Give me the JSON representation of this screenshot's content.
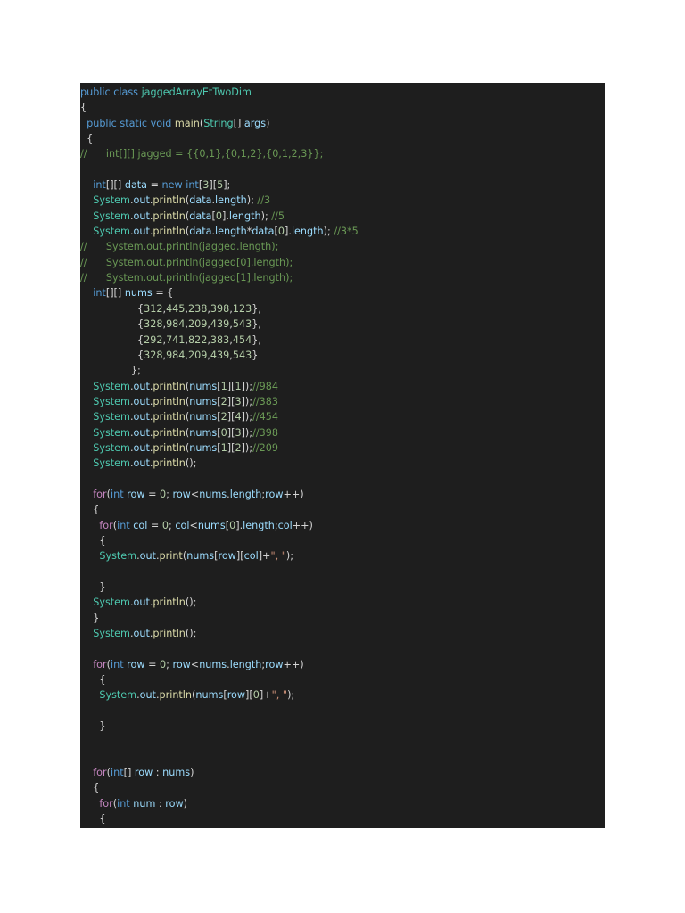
{
  "code": {
    "lines": [
      [
        [
          "public",
          "kw"
        ],
        [
          " ",
          "pl"
        ],
        [
          "class",
          "kw"
        ],
        [
          " ",
          "pl"
        ],
        [
          "jaggedArrayEtTwoDim",
          "type"
        ]
      ],
      [
        [
          "{",
          "pl"
        ]
      ],
      [
        [
          "  ",
          "pl"
        ],
        [
          "public",
          "kw"
        ],
        [
          " ",
          "pl"
        ],
        [
          "static",
          "kw"
        ],
        [
          " ",
          "pl"
        ],
        [
          "void",
          "kw"
        ],
        [
          " ",
          "pl"
        ],
        [
          "main",
          "fn"
        ],
        [
          "(",
          "pl"
        ],
        [
          "String",
          "type"
        ],
        [
          "[] ",
          "pl"
        ],
        [
          "args",
          "var"
        ],
        [
          ")",
          "pl"
        ]
      ],
      [
        [
          "  {",
          "pl"
        ]
      ],
      [
        [
          "//      int[][] jagged = {{0,1},{0,1,2},{0,1,2,3}};",
          "cm"
        ]
      ],
      [],
      [
        [
          "    ",
          "pl"
        ],
        [
          "int",
          "kw"
        ],
        [
          "[][] ",
          "pl"
        ],
        [
          "data",
          "var"
        ],
        [
          " = ",
          "pl"
        ],
        [
          "new",
          "kw"
        ],
        [
          " ",
          "pl"
        ],
        [
          "int",
          "kw"
        ],
        [
          "[",
          "pl"
        ],
        [
          "3",
          "num"
        ],
        [
          "][",
          "pl"
        ],
        [
          "5",
          "num"
        ],
        [
          "];",
          "pl"
        ]
      ],
      [
        [
          "    ",
          "pl"
        ],
        [
          "System",
          "type"
        ],
        [
          ".",
          "pl"
        ],
        [
          "out",
          "var"
        ],
        [
          ".",
          "pl"
        ],
        [
          "println",
          "fn"
        ],
        [
          "(",
          "pl"
        ],
        [
          "data",
          "var"
        ],
        [
          ".",
          "pl"
        ],
        [
          "length",
          "var"
        ],
        [
          "); ",
          "pl"
        ],
        [
          "//3",
          "cm"
        ]
      ],
      [
        [
          "    ",
          "pl"
        ],
        [
          "System",
          "type"
        ],
        [
          ".",
          "pl"
        ],
        [
          "out",
          "var"
        ],
        [
          ".",
          "pl"
        ],
        [
          "println",
          "fn"
        ],
        [
          "(",
          "pl"
        ],
        [
          "data",
          "var"
        ],
        [
          "[",
          "pl"
        ],
        [
          "0",
          "num"
        ],
        [
          "].",
          "pl"
        ],
        [
          "length",
          "var"
        ],
        [
          "); ",
          "pl"
        ],
        [
          "//5",
          "cm"
        ]
      ],
      [
        [
          "    ",
          "pl"
        ],
        [
          "System",
          "type"
        ],
        [
          ".",
          "pl"
        ],
        [
          "out",
          "var"
        ],
        [
          ".",
          "pl"
        ],
        [
          "println",
          "fn"
        ],
        [
          "(",
          "pl"
        ],
        [
          "data",
          "var"
        ],
        [
          ".",
          "pl"
        ],
        [
          "length",
          "var"
        ],
        [
          "*",
          "pl"
        ],
        [
          "data",
          "var"
        ],
        [
          "[",
          "pl"
        ],
        [
          "0",
          "num"
        ],
        [
          "].",
          "pl"
        ],
        [
          "length",
          "var"
        ],
        [
          "); ",
          "pl"
        ],
        [
          "//3*5",
          "cm"
        ]
      ],
      [
        [
          "//      System.out.println(jagged.length);",
          "cm"
        ]
      ],
      [
        [
          "//      System.out.println(jagged[0].length);",
          "cm"
        ]
      ],
      [
        [
          "//      System.out.println(jagged[1].length);",
          "cm"
        ]
      ],
      [
        [
          "    ",
          "pl"
        ],
        [
          "int",
          "kw"
        ],
        [
          "[][] ",
          "pl"
        ],
        [
          "nums",
          "var"
        ],
        [
          " = {",
          "pl"
        ]
      ],
      [
        [
          "                  {",
          "pl"
        ],
        [
          "312",
          "num"
        ],
        [
          ",",
          "pl"
        ],
        [
          "445",
          "num"
        ],
        [
          ",",
          "pl"
        ],
        [
          "238",
          "num"
        ],
        [
          ",",
          "pl"
        ],
        [
          "398",
          "num"
        ],
        [
          ",",
          "pl"
        ],
        [
          "123",
          "num"
        ],
        [
          "},",
          "pl"
        ]
      ],
      [
        [
          "                  {",
          "pl"
        ],
        [
          "328",
          "num"
        ],
        [
          ",",
          "pl"
        ],
        [
          "984",
          "num"
        ],
        [
          ",",
          "pl"
        ],
        [
          "209",
          "num"
        ],
        [
          ",",
          "pl"
        ],
        [
          "439",
          "num"
        ],
        [
          ",",
          "pl"
        ],
        [
          "543",
          "num"
        ],
        [
          "},",
          "pl"
        ]
      ],
      [
        [
          "                  {",
          "pl"
        ],
        [
          "292",
          "num"
        ],
        [
          ",",
          "pl"
        ],
        [
          "741",
          "num"
        ],
        [
          ",",
          "pl"
        ],
        [
          "822",
          "num"
        ],
        [
          ",",
          "pl"
        ],
        [
          "383",
          "num"
        ],
        [
          ",",
          "pl"
        ],
        [
          "454",
          "num"
        ],
        [
          "},",
          "pl"
        ]
      ],
      [
        [
          "                  {",
          "pl"
        ],
        [
          "328",
          "num"
        ],
        [
          ",",
          "pl"
        ],
        [
          "984",
          "num"
        ],
        [
          ",",
          "pl"
        ],
        [
          "209",
          "num"
        ],
        [
          ",",
          "pl"
        ],
        [
          "439",
          "num"
        ],
        [
          ",",
          "pl"
        ],
        [
          "543",
          "num"
        ],
        [
          "}",
          "pl"
        ]
      ],
      [
        [
          "                };",
          "pl"
        ]
      ],
      [
        [
          "    ",
          "pl"
        ],
        [
          "System",
          "type"
        ],
        [
          ".",
          "pl"
        ],
        [
          "out",
          "var"
        ],
        [
          ".",
          "pl"
        ],
        [
          "println",
          "fn"
        ],
        [
          "(",
          "pl"
        ],
        [
          "nums",
          "var"
        ],
        [
          "[",
          "pl"
        ],
        [
          "1",
          "num"
        ],
        [
          "][",
          "pl"
        ],
        [
          "1",
          "num"
        ],
        [
          "]);",
          "pl"
        ],
        [
          "//984",
          "cm"
        ]
      ],
      [
        [
          "    ",
          "pl"
        ],
        [
          "System",
          "type"
        ],
        [
          ".",
          "pl"
        ],
        [
          "out",
          "var"
        ],
        [
          ".",
          "pl"
        ],
        [
          "println",
          "fn"
        ],
        [
          "(",
          "pl"
        ],
        [
          "nums",
          "var"
        ],
        [
          "[",
          "pl"
        ],
        [
          "2",
          "num"
        ],
        [
          "][",
          "pl"
        ],
        [
          "3",
          "num"
        ],
        [
          "]);",
          "pl"
        ],
        [
          "//383",
          "cm"
        ]
      ],
      [
        [
          "    ",
          "pl"
        ],
        [
          "System",
          "type"
        ],
        [
          ".",
          "pl"
        ],
        [
          "out",
          "var"
        ],
        [
          ".",
          "pl"
        ],
        [
          "println",
          "fn"
        ],
        [
          "(",
          "pl"
        ],
        [
          "nums",
          "var"
        ],
        [
          "[",
          "pl"
        ],
        [
          "2",
          "num"
        ],
        [
          "][",
          "pl"
        ],
        [
          "4",
          "num"
        ],
        [
          "]);",
          "pl"
        ],
        [
          "//454",
          "cm"
        ]
      ],
      [
        [
          "    ",
          "pl"
        ],
        [
          "System",
          "type"
        ],
        [
          ".",
          "pl"
        ],
        [
          "out",
          "var"
        ],
        [
          ".",
          "pl"
        ],
        [
          "println",
          "fn"
        ],
        [
          "(",
          "pl"
        ],
        [
          "nums",
          "var"
        ],
        [
          "[",
          "pl"
        ],
        [
          "0",
          "num"
        ],
        [
          "][",
          "pl"
        ],
        [
          "3",
          "num"
        ],
        [
          "]);",
          "pl"
        ],
        [
          "//398",
          "cm"
        ]
      ],
      [
        [
          "    ",
          "pl"
        ],
        [
          "System",
          "type"
        ],
        [
          ".",
          "pl"
        ],
        [
          "out",
          "var"
        ],
        [
          ".",
          "pl"
        ],
        [
          "println",
          "fn"
        ],
        [
          "(",
          "pl"
        ],
        [
          "nums",
          "var"
        ],
        [
          "[",
          "pl"
        ],
        [
          "1",
          "num"
        ],
        [
          "][",
          "pl"
        ],
        [
          "2",
          "num"
        ],
        [
          "]);",
          "pl"
        ],
        [
          "//209",
          "cm"
        ]
      ],
      [
        [
          "    ",
          "pl"
        ],
        [
          "System",
          "type"
        ],
        [
          ".",
          "pl"
        ],
        [
          "out",
          "var"
        ],
        [
          ".",
          "pl"
        ],
        [
          "println",
          "fn"
        ],
        [
          "();",
          "pl"
        ]
      ],
      [],
      [
        [
          "    ",
          "pl"
        ],
        [
          "for",
          "ctl"
        ],
        [
          "(",
          "pl"
        ],
        [
          "int",
          "kw"
        ],
        [
          " ",
          "pl"
        ],
        [
          "row",
          "var"
        ],
        [
          " = ",
          "pl"
        ],
        [
          "0",
          "num"
        ],
        [
          "; ",
          "pl"
        ],
        [
          "row",
          "var"
        ],
        [
          "<",
          "pl"
        ],
        [
          "nums",
          "var"
        ],
        [
          ".",
          "pl"
        ],
        [
          "length",
          "var"
        ],
        [
          ";",
          "pl"
        ],
        [
          "row",
          "var"
        ],
        [
          "++)",
          "pl"
        ]
      ],
      [
        [
          "    {",
          "pl"
        ]
      ],
      [
        [
          "      ",
          "pl"
        ],
        [
          "for",
          "ctl"
        ],
        [
          "(",
          "pl"
        ],
        [
          "int",
          "kw"
        ],
        [
          " ",
          "pl"
        ],
        [
          "col",
          "var"
        ],
        [
          " = ",
          "pl"
        ],
        [
          "0",
          "num"
        ],
        [
          "; ",
          "pl"
        ],
        [
          "col",
          "var"
        ],
        [
          "<",
          "pl"
        ],
        [
          "nums",
          "var"
        ],
        [
          "[",
          "pl"
        ],
        [
          "0",
          "num"
        ],
        [
          "].",
          "pl"
        ],
        [
          "length",
          "var"
        ],
        [
          ";",
          "pl"
        ],
        [
          "col",
          "var"
        ],
        [
          "++)",
          "pl"
        ]
      ],
      [
        [
          "      {",
          "pl"
        ]
      ],
      [
        [
          "      ",
          "pl"
        ],
        [
          "System",
          "type"
        ],
        [
          ".",
          "pl"
        ],
        [
          "out",
          "var"
        ],
        [
          ".",
          "pl"
        ],
        [
          "print",
          "fn"
        ],
        [
          "(",
          "pl"
        ],
        [
          "nums",
          "var"
        ],
        [
          "[",
          "pl"
        ],
        [
          "row",
          "var"
        ],
        [
          "][",
          "pl"
        ],
        [
          "col",
          "var"
        ],
        [
          "]+",
          "pl"
        ],
        [
          "\", \"",
          "str"
        ],
        [
          ");",
          "pl"
        ]
      ],
      [],
      [
        [
          "      }",
          "pl"
        ]
      ],
      [
        [
          "    ",
          "pl"
        ],
        [
          "System",
          "type"
        ],
        [
          ".",
          "pl"
        ],
        [
          "out",
          "var"
        ],
        [
          ".",
          "pl"
        ],
        [
          "println",
          "fn"
        ],
        [
          "();",
          "pl"
        ]
      ],
      [
        [
          "    }",
          "pl"
        ]
      ],
      [
        [
          "    ",
          "pl"
        ],
        [
          "System",
          "type"
        ],
        [
          ".",
          "pl"
        ],
        [
          "out",
          "var"
        ],
        [
          ".",
          "pl"
        ],
        [
          "println",
          "fn"
        ],
        [
          "();",
          "pl"
        ]
      ],
      [],
      [
        [
          "    ",
          "pl"
        ],
        [
          "for",
          "ctl"
        ],
        [
          "(",
          "pl"
        ],
        [
          "int",
          "kw"
        ],
        [
          " ",
          "pl"
        ],
        [
          "row",
          "var"
        ],
        [
          " = ",
          "pl"
        ],
        [
          "0",
          "num"
        ],
        [
          "; ",
          "pl"
        ],
        [
          "row",
          "var"
        ],
        [
          "<",
          "pl"
        ],
        [
          "nums",
          "var"
        ],
        [
          ".",
          "pl"
        ],
        [
          "length",
          "var"
        ],
        [
          ";",
          "pl"
        ],
        [
          "row",
          "var"
        ],
        [
          "++)",
          "pl"
        ]
      ],
      [
        [
          "      {",
          "pl"
        ]
      ],
      [
        [
          "      ",
          "pl"
        ],
        [
          "System",
          "type"
        ],
        [
          ".",
          "pl"
        ],
        [
          "out",
          "var"
        ],
        [
          ".",
          "pl"
        ],
        [
          "println",
          "fn"
        ],
        [
          "(",
          "pl"
        ],
        [
          "nums",
          "var"
        ],
        [
          "[",
          "pl"
        ],
        [
          "row",
          "var"
        ],
        [
          "][",
          "pl"
        ],
        [
          "0",
          "num"
        ],
        [
          "]+",
          "pl"
        ],
        [
          "\", \"",
          "str"
        ],
        [
          ");",
          "pl"
        ]
      ],
      [],
      [
        [
          "      }",
          "pl"
        ]
      ],
      [],
      [],
      [
        [
          "    ",
          "pl"
        ],
        [
          "for",
          "ctl"
        ],
        [
          "(",
          "pl"
        ],
        [
          "int",
          "kw"
        ],
        [
          "[] ",
          "pl"
        ],
        [
          "row",
          "var"
        ],
        [
          " : ",
          "pl"
        ],
        [
          "nums",
          "var"
        ],
        [
          ")",
          "pl"
        ]
      ],
      [
        [
          "    {",
          "pl"
        ]
      ],
      [
        [
          "      ",
          "pl"
        ],
        [
          "for",
          "ctl"
        ],
        [
          "(",
          "pl"
        ],
        [
          "int",
          "kw"
        ],
        [
          " ",
          "pl"
        ],
        [
          "num",
          "var"
        ],
        [
          " : ",
          "pl"
        ],
        [
          "row",
          "var"
        ],
        [
          ")",
          "pl"
        ]
      ],
      [
        [
          "      {",
          "pl"
        ]
      ]
    ]
  }
}
